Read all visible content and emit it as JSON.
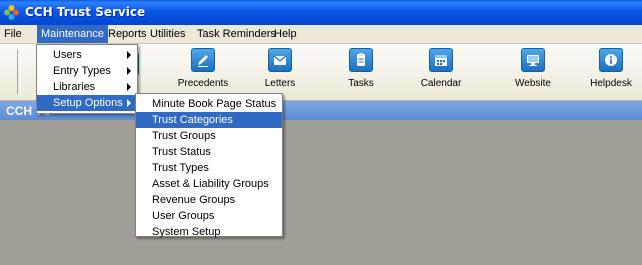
{
  "window": {
    "title": "CCH Trust Service",
    "icon": "cch-logo-icon"
  },
  "menubar": {
    "items": [
      "File",
      "Maintenance",
      "Reports",
      "Utilities",
      "Task Reminders",
      "Help"
    ],
    "active": "Maintenance"
  },
  "toolbar": {
    "partial_label": "e",
    "buttons": [
      {
        "label": "Precedents",
        "icon": "pen-icon"
      },
      {
        "label": "Letters",
        "icon": "envelope-icon"
      },
      {
        "label": "Tasks",
        "icon": "clipboard-icon"
      },
      {
        "label": "Calendar",
        "icon": "calendar-icon"
      },
      {
        "label": "Website",
        "icon": "monitor-icon"
      },
      {
        "label": "Helpdesk",
        "icon": "info-icon"
      }
    ]
  },
  "bluebar": {
    "text": "CCH TC"
  },
  "maintenance_menu": {
    "items": [
      "Users",
      "Entry Types",
      "Libraries",
      "Setup Options"
    ],
    "highlighted": "Setup Options"
  },
  "setup_submenu": {
    "items": [
      "Minute Book Page Status",
      "Trust Categories",
      "Trust Groups",
      "Trust Status",
      "Trust Types",
      "Asset & Liability Groups",
      "Revenue Groups",
      "User Groups",
      "System Setup"
    ],
    "highlighted": "Trust Categories"
  }
}
